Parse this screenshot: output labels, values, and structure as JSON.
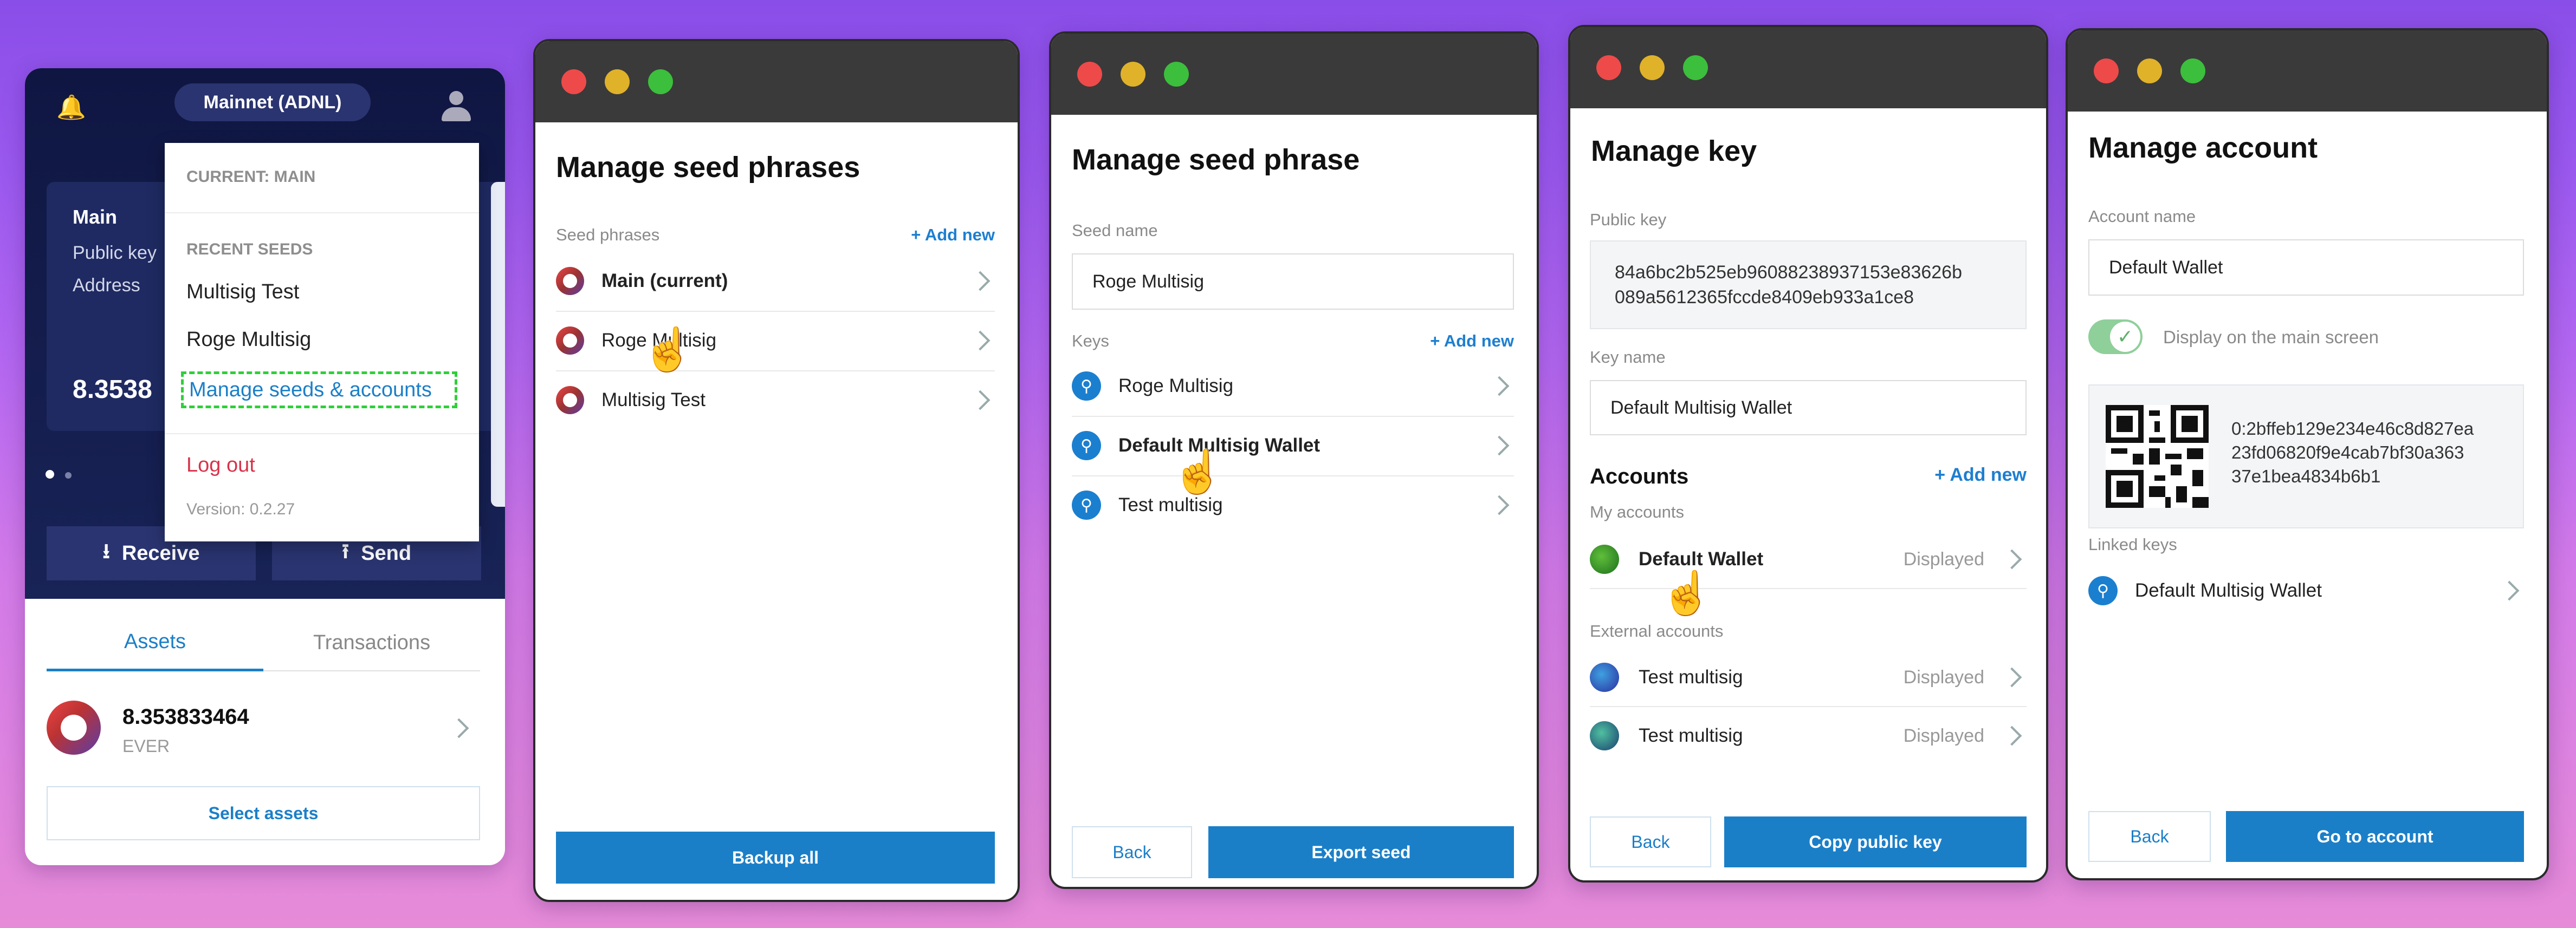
{
  "wallet": {
    "network": "Mainnet (ADNL)",
    "account_name": "Main",
    "public_key_label": "Public key",
    "address_label": "Address",
    "balance_partial": "8.3538",
    "receive": "Receive",
    "send": "Send",
    "tabs": [
      "Assets",
      "Transactions"
    ],
    "asset": {
      "amount": "8.353833464",
      "ticker": "EVER"
    },
    "select_assets": "Select assets",
    "menu": {
      "current": "CURRENT: MAIN",
      "recent_header": "RECENT SEEDS",
      "recent": [
        "Multisig Test",
        "Roge Multisig"
      ],
      "manage": "Manage seeds & accounts",
      "logout": "Log out",
      "version": "Version: 0.2.27"
    }
  },
  "seeds": {
    "title": "Manage seed phrases",
    "section": "Seed phrases",
    "add_new": "+ Add new",
    "items": [
      "Main (current)",
      "Roge Multisig",
      "Multisig Test"
    ],
    "backup": "Backup all"
  },
  "seed": {
    "title": "Manage seed phrase",
    "name_label": "Seed name",
    "name_value": "Roge Multisig",
    "keys_label": "Keys",
    "add_new": "+ Add new",
    "keys": [
      "Roge Multisig",
      "Default Multisig Wallet",
      "Test multisig"
    ],
    "back": "Back",
    "export": "Export seed"
  },
  "key": {
    "title": "Manage key",
    "pubkey_label": "Public key",
    "pubkey_line1": "84a6bc2b525eb96088238937153e83626b",
    "pubkey_line2": "089a5612365fccde8409eb933a1ce8",
    "keyname_label": "Key name",
    "keyname_value": "Default Multisig Wallet",
    "accounts_title": "Accounts",
    "add_new": "+ Add new",
    "my_accounts": "My accounts",
    "my_items": [
      {
        "name": "Default Wallet",
        "status": "Displayed"
      }
    ],
    "external_label": "External accounts",
    "external_items": [
      {
        "name": "Test multisig",
        "status": "Displayed"
      },
      {
        "name": "Test multisig",
        "status": "Displayed"
      }
    ],
    "back": "Back",
    "copy": "Copy public key"
  },
  "account": {
    "title": "Manage account",
    "name_label": "Account name",
    "name_value": "Default Wallet",
    "display_label": "Display on the main screen",
    "address_line1": "0:2bffeb129e234e46c8d827ea",
    "address_line2": "23fd06820f9e4cab7bf30a363",
    "address_line3": "37e1bea4834b6b1",
    "linked_label": "Linked keys",
    "linked_items": [
      "Default Multisig Wallet"
    ],
    "back": "Back",
    "go": "Go to account"
  },
  "colors": {
    "accent": "#1b7fc8",
    "danger": "#d8334a",
    "dark_bg": "#1a1f4a"
  }
}
